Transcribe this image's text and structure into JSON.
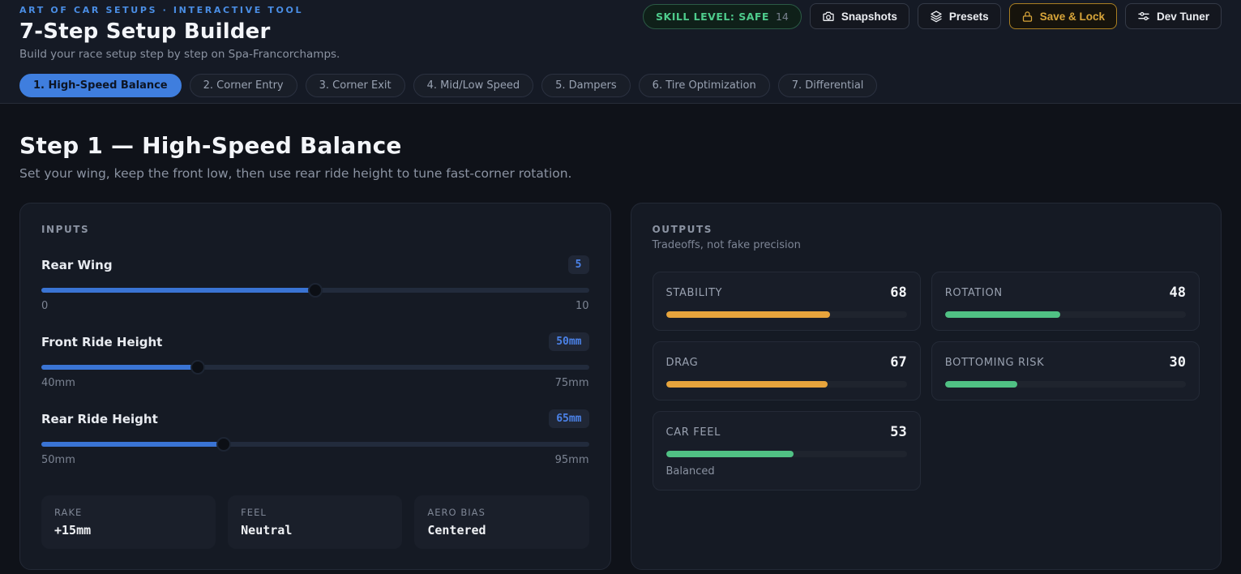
{
  "header": {
    "eyebrow": "ART OF CAR SETUPS · INTERACTIVE TOOL",
    "title": "7-Step Setup Builder",
    "subtitle": "Build your race setup step by step on Spa-Francorchamps.",
    "skill_badge": {
      "label": "SKILL LEVEL: SAFE",
      "count": "14"
    },
    "buttons": [
      {
        "label": "Snapshots",
        "icon": "camera-icon"
      },
      {
        "label": "Presets",
        "icon": "layers-icon"
      },
      {
        "label": "Save & Lock",
        "icon": "lock-icon",
        "accent": "#d9a63a"
      },
      {
        "label": "Dev Tuner",
        "icon": "sliders-icon"
      }
    ]
  },
  "tabs": [
    {
      "label": "1. High-Speed Balance",
      "active": true
    },
    {
      "label": "2. Corner Entry",
      "active": false
    },
    {
      "label": "3. Corner Exit",
      "active": false
    },
    {
      "label": "4. Mid/Low Speed",
      "active": false
    },
    {
      "label": "5. Dampers",
      "active": false
    },
    {
      "label": "6. Tire Optimization",
      "active": false
    },
    {
      "label": "7. Differential",
      "active": false
    }
  ],
  "step": {
    "title": "Step 1 — High-Speed Balance",
    "description": "Set your wing, keep the front low, then use rear ride height to tune fast-corner rotation."
  },
  "inputs": {
    "section_label": "INPUTS",
    "sliders": [
      {
        "label": "Rear Wing",
        "value": "5",
        "min_label": "0",
        "max_label": "10",
        "percent": 50
      },
      {
        "label": "Front Ride Height",
        "value": "50mm",
        "min_label": "40mm",
        "max_label": "75mm",
        "percent": 28.6
      },
      {
        "label": "Rear Ride Height",
        "value": "65mm",
        "min_label": "50mm",
        "max_label": "95mm",
        "percent": 33.3
      }
    ],
    "stats": [
      {
        "label": "RAKE",
        "value": "+15mm"
      },
      {
        "label": "FEEL",
        "value": "Neutral"
      },
      {
        "label": "AERO BIAS",
        "value": "Centered"
      }
    ]
  },
  "outputs": {
    "section_label": "OUTPUTS",
    "section_subtitle": "Tradeoffs, not fake precision",
    "metrics": [
      {
        "label": "STABILITY",
        "value": 68,
        "color": "#e7a43c"
      },
      {
        "label": "ROTATION",
        "value": 48,
        "color": "#50c184"
      },
      {
        "label": "DRAG",
        "value": 67,
        "color": "#e7a43c"
      },
      {
        "label": "BOTTOMING RISK",
        "value": 30,
        "color": "#50c184"
      },
      {
        "label": "CAR FEEL",
        "value": 53,
        "color": "#50c184",
        "note": "Balanced"
      }
    ]
  },
  "colors": {
    "accent_blue": "#3f7ede",
    "accent_green": "#50c184",
    "accent_amber": "#e7a43c",
    "page_bg": "#0f1219",
    "header_bg": "#151a25",
    "card_bg": "#151a24"
  }
}
